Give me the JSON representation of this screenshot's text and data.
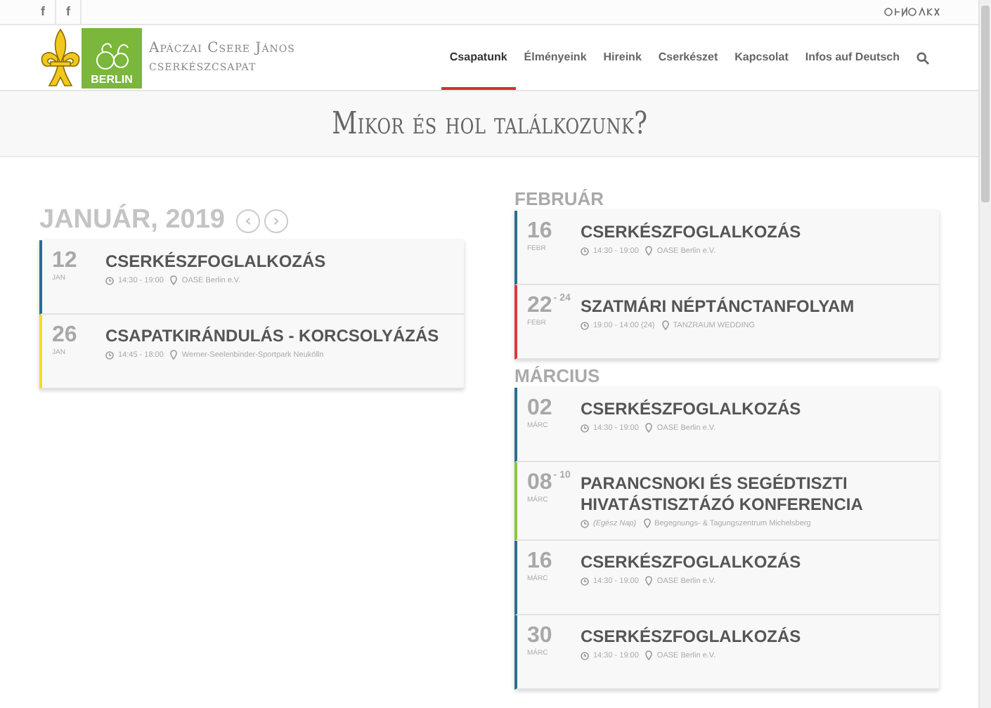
{
  "top_bar": {
    "social": [
      {
        "label": "f"
      },
      {
        "label": "f"
      }
    ]
  },
  "logo": {
    "badge": "BERLIN",
    "name_line1": "Apáczai Csere János",
    "name_line2": "cserkészcsapat"
  },
  "nav": [
    {
      "label": "Csapatunk",
      "selected": true
    },
    {
      "label": "Élményeink",
      "selected": false
    },
    {
      "label": "Hireink",
      "selected": false
    },
    {
      "label": "Cserkészet",
      "selected": false
    },
    {
      "label": "Kapcsolat",
      "selected": false
    },
    {
      "label": "Infos auf Deutsch",
      "selected": false
    }
  ],
  "page_title": "Mikor és hol találkozunk?",
  "calendar": {
    "title": "JANUÁR, 2019",
    "prev": "‹",
    "next": "›",
    "events": [
      {
        "day": "12",
        "month": "JAN",
        "title": "CSERKÉSZFOGLALKOZÁS",
        "time": "14:30 - 19:00",
        "place": "OASE Berlin e.V.",
        "all_day": false,
        "color": "#2a6f8f"
      },
      {
        "day": "26",
        "month": "JAN",
        "title": "CSAPATKIRÁNDULÁS - KORCSOLYÁZÁS",
        "time": "14:45 - 18:00",
        "place": "Werner-Seelenbinder-Sportpark Neukölln",
        "all_day": false,
        "color": "#f0e020"
      }
    ]
  },
  "upcoming": [
    {
      "month": "FEBRUÁR",
      "events": [
        {
          "day": "16",
          "month": "FEBR",
          "title": "CSERKÉSZFOGLALKOZÁS",
          "time": "14:30 - 19:00",
          "place": "OASE Berlin e.V.",
          "all_day": false,
          "color": "#2a6f8f"
        },
        {
          "day": "22",
          "day_end": "- 24",
          "month": "FEBR",
          "title": "SZATMÁRI NÉPTÁNCTANFOLYAM",
          "time": "19:00 - 14:00 (24)",
          "place": "TANZRAUM WEDDING",
          "all_day": false,
          "color": "#d83a3a"
        }
      ]
    },
    {
      "month": "MÁRCIUS",
      "events": [
        {
          "day": "02",
          "month": "MÁRC",
          "title": "CSERKÉSZFOGLALKOZÁS",
          "time": "14:30 - 19:00",
          "place": "OASE Berlin e.V.",
          "all_day": false,
          "color": "#2a6f8f"
        },
        {
          "day": "08",
          "day_end": "- 10",
          "month": "MÁRC",
          "title": "PARANCSNOKI ÉS SEGÉDTISZTI HIVATÁSTISZTÁZÓ KONFERENCIA",
          "time": "(Egész Nap)",
          "place": "Begegnungs- & Tagungszentrum Michelsberg",
          "all_day": true,
          "color": "#8cc63f"
        },
        {
          "day": "16",
          "month": "MÁRC",
          "title": "CSERKÉSZFOGLALKOZÁS",
          "time": "14:30 - 19:00",
          "place": "OASE Berlin e.V.",
          "all_day": false,
          "color": "#2a6f8f"
        },
        {
          "day": "30",
          "month": "MÁRC",
          "title": "CSERKÉSZFOGLALKOZÁS",
          "time": "14:30 - 19:00",
          "place": "OASE Berlin e.V.",
          "all_day": false,
          "color": "#2a6f8f"
        }
      ]
    }
  ]
}
